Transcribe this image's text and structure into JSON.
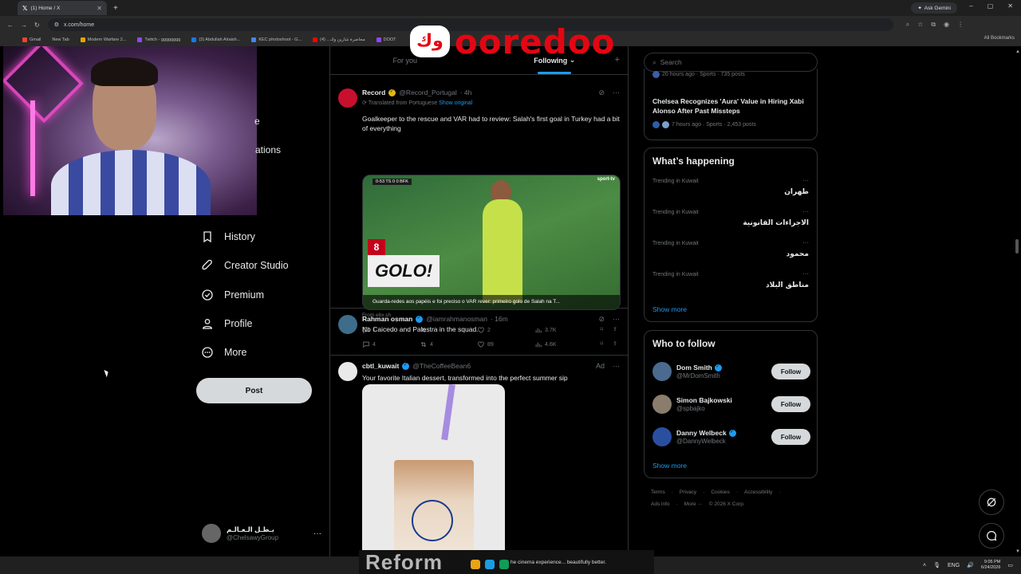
{
  "browser": {
    "tab_title": "(1) Home / X",
    "url": "x.com/home",
    "ask_gemini": "Ask Gemini",
    "all_bookmarks": "All Bookmarks",
    "bookmarks": [
      "Gmail",
      "New Tab",
      "Modern Warfare 2...",
      "Twitch - gggggggg",
      "(3) Abdullah Alraish...",
      "KEC photoshoot - G...",
      "محاضرة شارين وك... (4)",
      "DOOT"
    ]
  },
  "overlay": {
    "brand_ar": "وك",
    "brand_en": "ooredoo"
  },
  "nav": {
    "partial_1": "e",
    "partial_2": "ations",
    "items": [
      {
        "label": "History"
      },
      {
        "label": "Creator Studio"
      },
      {
        "label": "Premium"
      },
      {
        "label": "Profile"
      },
      {
        "label": "More"
      }
    ],
    "post_label": "Post",
    "account": {
      "name": "بـطـل الـعـالـم",
      "handle": "@ChelsawyGroup",
      "more": "···"
    }
  },
  "feed": {
    "tabs": [
      {
        "label": "For you"
      },
      {
        "label": "Following"
      }
    ],
    "tweets": [
      {
        "name": "Record",
        "handle": "@Record_Portugal",
        "time": "· 4h",
        "translated_prefix": "Translated from Portuguese",
        "show_original": "Show original",
        "text": "Goalkeeper to the rescue and VAR had to review: Salah's first goal in Turkey had a bit of everything",
        "media": {
          "score": "0-53  TS  0 0  BFK",
          "channel": "sport-tv",
          "badge_number": "8",
          "golo": "GOLO!",
          "caption": "Guarda-redes aos papéis e foi preciso o VAR rever: primeiro golo de Salah na T..."
        },
        "from": "From ebx.sh",
        "replies": "1",
        "retweets": "",
        "likes": "2",
        "views": "3.7K"
      },
      {
        "name": "Rahman osman",
        "handle": "@iamrahmanosman",
        "time": "· 16m",
        "text": "No Caicedo and Palestra in the squad.",
        "replies": "4",
        "retweets": "4",
        "likes": "89",
        "views": "4.6K"
      },
      {
        "name": "cbtl_kuwait",
        "handle": "@TheCoffeeBean6",
        "ad": "Ad",
        "text": "Your favorite Italian dessert, transformed into the perfect summer sip"
      }
    ]
  },
  "sidebar": {
    "search_placeholder": "Search",
    "news_partial_meta": "20 hours ago · Sports · 735 posts",
    "news": {
      "title": "Chelsea Recognizes 'Aura' Value in Hiring Xabi Alonso After Past Missteps",
      "meta": "7 hours ago · Sports · 2,453 posts"
    },
    "whats_happening": "What’s happening",
    "trends": [
      {
        "context": "Trending in Kuwait",
        "name": "طهران"
      },
      {
        "context": "Trending in Kuwait",
        "name": "الاجراءات القانونية"
      },
      {
        "context": "Trending in Kuwait",
        "name": "محمود"
      },
      {
        "context": "Trending in Kuwait",
        "name": "مناطق البلاد"
      }
    ],
    "show_more": "Show more",
    "who_to_follow": "Who to follow",
    "follow_label": "Follow",
    "suggestions": [
      {
        "name": "Dom Smith",
        "handle": "@MrDomSmith",
        "verified": true
      },
      {
        "name": "Simon Bajkowski",
        "handle": "@spbajko",
        "verified": false
      },
      {
        "name": "Danny Welbeck",
        "handle": "@DannyWelbeck",
        "verified": true
      }
    ],
    "footer_row1": [
      "Terms",
      "Privacy",
      "Cookies",
      "Accessibility",
      "·"
    ],
    "footer_row2": [
      "Ads info",
      "More ···",
      "© 2026 X Corp."
    ]
  },
  "taskbar": {
    "media_text": "Reform",
    "ticker": "he cinema experience... beautifully better.",
    "lang": "ENG",
    "time": "9:05 PM",
    "date": "6/24/2026"
  },
  "colors": {
    "accent": "#1d9bf0",
    "verified_gold": "#e2b719",
    "brand_red": "#e30613"
  }
}
